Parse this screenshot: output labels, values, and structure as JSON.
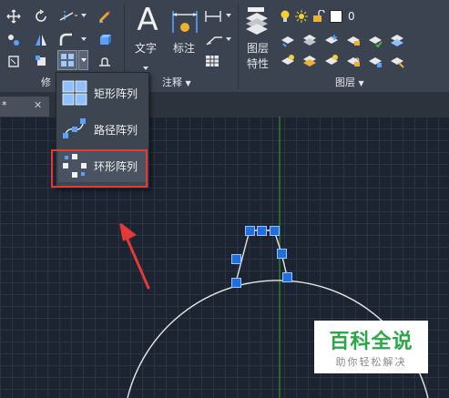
{
  "ribbon": {
    "modify_panel_title": "修改",
    "annotation_panel_title": "注释",
    "layer_panel_title": "图层",
    "text_label": "文字",
    "dimension_label": "标注",
    "layer_properties_label_line1": "图层",
    "layer_properties_label_line2": "特性",
    "current_layer_value": "0"
  },
  "array_menu": {
    "items": [
      {
        "label": "矩形阵列",
        "icon": "rectangular-array-icon"
      },
      {
        "label": "路径阵列",
        "icon": "path-array-icon"
      },
      {
        "label": "环形阵列",
        "icon": "polar-array-icon"
      }
    ],
    "highlighted_index": 2
  },
  "drawing_tab": {
    "title": "*",
    "close_glyph": "✕"
  },
  "watermark": {
    "main": "百科全说",
    "sub": "助你轻松解决"
  },
  "colors": {
    "accent_red": "#e53935",
    "grip_blue": "#1f6fe0",
    "watermark_green": "#2aa747",
    "axis_green": "#2e7d32"
  }
}
